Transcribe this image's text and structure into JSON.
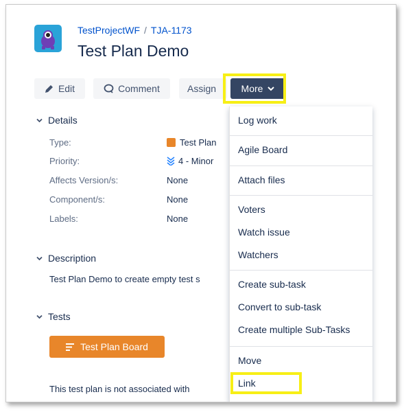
{
  "breadcrumb": {
    "project": "TestProjectWF",
    "separator": "/",
    "issue_key": "TJA-1173"
  },
  "issue": {
    "title": "Test Plan Demo"
  },
  "toolbar": {
    "edit": "Edit",
    "comment": "Comment",
    "assign": "Assign",
    "more": "More"
  },
  "details": {
    "heading": "Details",
    "fields": [
      {
        "label": "Type:",
        "value": "Test Plan"
      },
      {
        "label": "Priority:",
        "value": "4 - Minor"
      },
      {
        "label": "Affects Version/s:",
        "value": "None"
      },
      {
        "label": "Component/s:",
        "value": "None"
      },
      {
        "label": "Labels:",
        "value": "None"
      }
    ]
  },
  "description": {
    "heading": "Description",
    "text": "Test Plan Demo to create empty test s"
  },
  "tests": {
    "heading": "Tests",
    "board_button": "Test Plan Board",
    "note": "This test plan is not associated with"
  },
  "more_menu": {
    "items": [
      "Log work",
      "Agile Board",
      "Attach files",
      "Voters",
      "Watch issue",
      "Watchers",
      "Create sub-task",
      "Convert to sub-task",
      "Create multiple Sub-Tasks",
      "Move",
      "Link"
    ]
  },
  "colors": {
    "accent": "#344563",
    "link": "#0052cc",
    "highlight": "#f7ef16",
    "board_button": "#e8862a"
  }
}
